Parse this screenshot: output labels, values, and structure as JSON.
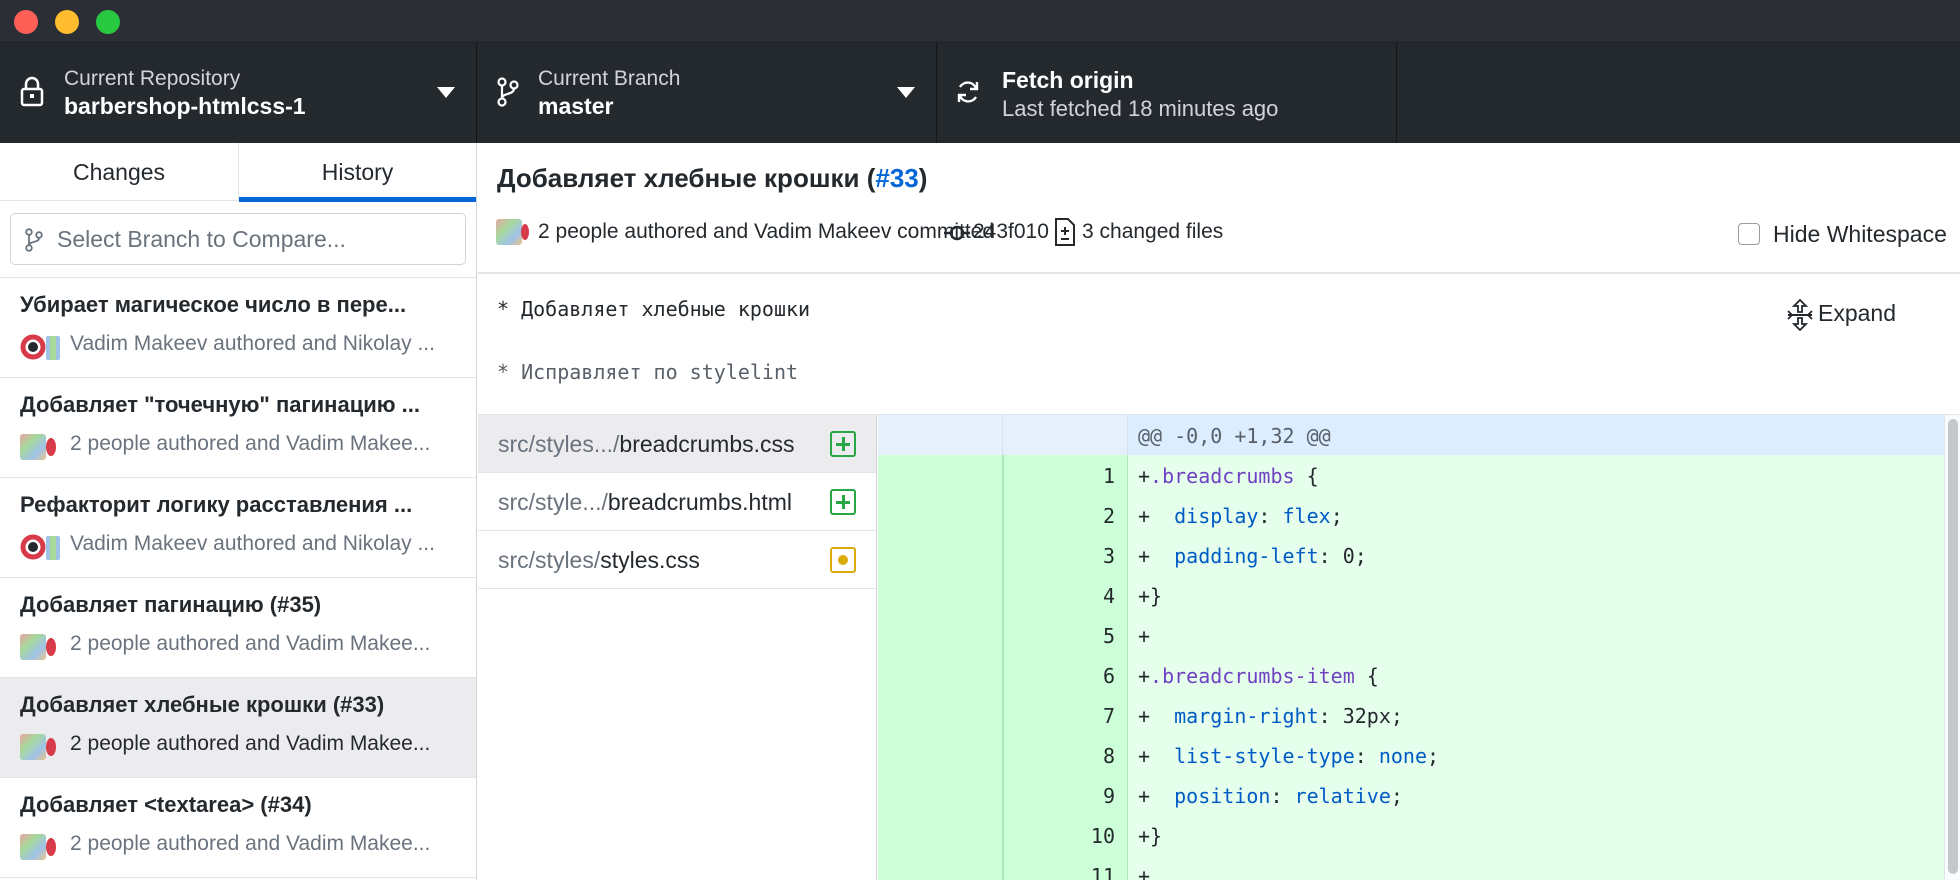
{
  "toolbar": {
    "repo": {
      "label": "Current Repository",
      "value": "barbershop-htmlcss-1"
    },
    "branch": {
      "label": "Current Branch",
      "value": "master"
    },
    "fetch": {
      "label": "Fetch origin",
      "sub": "Last fetched 18 minutes ago"
    }
  },
  "sidebar": {
    "tabs": [
      {
        "label": "Changes"
      },
      {
        "label": "History"
      }
    ],
    "active_tab": "History",
    "branch_compare_placeholder": "Select Branch to Compare...",
    "commits": [
      {
        "title": "Убирает магическое число в пере...",
        "meta": "Vadim Makeev authored and Nikolay ...",
        "avatar": "author-avatar-icon"
      },
      {
        "title": "Добавляет \"точечную\" пагинацию ...",
        "meta": "2 people authored and Vadim Makee...",
        "avatar": "multiple-authors-avatar-icon"
      },
      {
        "title": "Рефакторит логику расставления ...",
        "meta": "Vadim Makeev authored and Nikolay ...",
        "avatar": "author-avatar-icon"
      },
      {
        "title": "Добавляет пагинацию (#35)",
        "meta": "2 people authored and Vadim Makee...",
        "avatar": "multiple-authors-avatar-icon"
      },
      {
        "title": "Добавляет хлебные крошки (#33)",
        "meta": "2 people authored and Vadim Makee...",
        "avatar": "multiple-authors-avatar-icon",
        "selected": true
      },
      {
        "title": "Добавляет <textarea> (#34)",
        "meta": "2 people authored and Vadim Makee...",
        "avatar": "multiple-authors-avatar-icon"
      }
    ]
  },
  "commit": {
    "title_text": "Добавляет хлебные крошки (",
    "pr_number": "#33",
    "title_close": ")",
    "authors_text": "2 people authored and Vadim Makeev committed",
    "sha": "243f010",
    "changed_files": "3 changed files",
    "hide_whitespace_label": "Hide Whitespace",
    "message_line1": "* Добавляет хлебные крошки",
    "message_line2": "* Исправляет по stylelint",
    "expand_label": "Expand"
  },
  "files": [
    {
      "dir": "src/styles.../",
      "name": "breadcrumbs.css",
      "status": "added",
      "selected": true
    },
    {
      "dir": "src/style.../",
      "name": "breadcrumbs.html",
      "status": "added"
    },
    {
      "dir": "src/styles/",
      "name": "styles.css",
      "status": "modified"
    }
  ],
  "diff": {
    "hunk_header": "@@ -0,0 +1,32 @@",
    "lines": [
      {
        "n": "1",
        "code": "+.breadcrumbs {"
      },
      {
        "n": "2",
        "code": "+  display: flex;"
      },
      {
        "n": "3",
        "code": "+  padding-left: 0;"
      },
      {
        "n": "4",
        "code": "+}"
      },
      {
        "n": "5",
        "code": "+"
      },
      {
        "n": "6",
        "code": "+.breadcrumbs-item {"
      },
      {
        "n": "7",
        "code": "+  margin-right: 32px;"
      },
      {
        "n": "8",
        "code": "+  list-style-type: none;"
      },
      {
        "n": "9",
        "code": "+  position: relative;"
      },
      {
        "n": "10",
        "code": "+}"
      },
      {
        "n": "11",
        "code": "+"
      }
    ]
  },
  "colors": {
    "accent": "#0366d6",
    "added_bg": "#e6ffed",
    "hunk_bg": "#dbedff",
    "toolbar_bg": "#24292e"
  }
}
